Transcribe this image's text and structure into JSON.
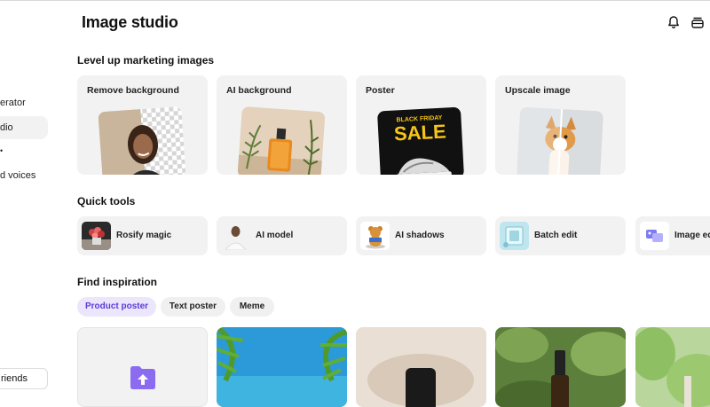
{
  "sidebar": {
    "items": [
      {
        "label": "erator"
      },
      {
        "label": "dio"
      },
      {
        "label": "•"
      },
      {
        "label": "d voices"
      }
    ],
    "invite_label": "riends"
  },
  "header": {
    "title": "Image studio",
    "icons": [
      "bell-icon",
      "stack-icon"
    ]
  },
  "sections": {
    "level_up": {
      "title": "Level up marketing images",
      "cards": [
        {
          "label": "Remove background"
        },
        {
          "label": "AI background"
        },
        {
          "label": "Poster",
          "poster_line1": "BLACK FRIDAY",
          "poster_line2": "SALE"
        },
        {
          "label": "Upscale image"
        }
      ]
    },
    "quick_tools": {
      "title": "Quick tools",
      "tools": [
        {
          "label": "Rosify magic"
        },
        {
          "label": "AI model"
        },
        {
          "label": "AI shadows"
        },
        {
          "label": "Batch edit"
        },
        {
          "label": "Image ed"
        }
      ]
    },
    "inspiration": {
      "title": "Find inspiration",
      "chips": [
        {
          "label": "Product poster",
          "active": true
        },
        {
          "label": "Text poster",
          "active": false
        },
        {
          "label": "Meme",
          "active": false
        }
      ]
    }
  },
  "colors": {
    "accent": "#5b3bd6",
    "chip_active_bg": "#ebe6fb",
    "card_bg": "#f2f2f2"
  }
}
